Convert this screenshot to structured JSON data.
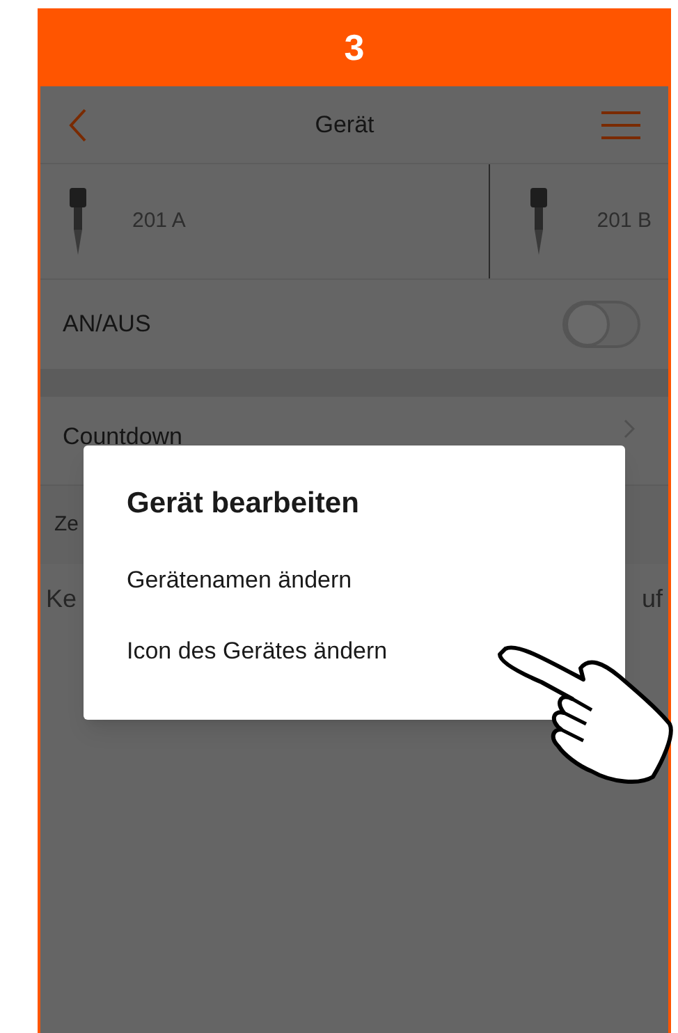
{
  "step": "3",
  "header": {
    "title": "Gerät"
  },
  "devices": [
    {
      "name": "201 A"
    },
    {
      "name": "201 B"
    }
  ],
  "power": {
    "label": "AN/AUS",
    "on": false
  },
  "rows": [
    {
      "label": "Countdown"
    },
    {
      "label": "Ze"
    }
  ],
  "note": {
    "left": "Ke",
    "right": "uf"
  },
  "dialog": {
    "title": "Gerät bearbeiten",
    "options": [
      "Gerätenamen ändern",
      "Icon des Gerätes ändern"
    ]
  }
}
